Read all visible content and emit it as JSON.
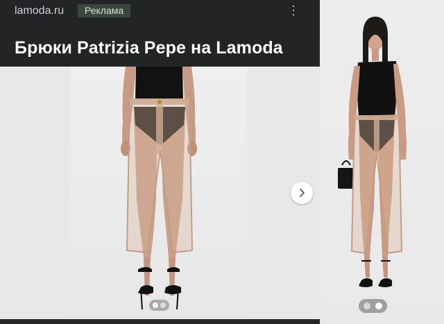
{
  "ad": {
    "domain": "lamoda.ru",
    "badge": "Реклама",
    "title": "Брюки Patrizia Pepe на Lamoda",
    "more_icon": "kebab-vertical-icon",
    "next_icon": "chevron-right-icon"
  },
  "carousel": {
    "main_image_alt": "product-photo-front-closeup",
    "side_image_alt": "product-photo-full-figure",
    "pages": 2,
    "current_page": 1
  },
  "colors": {
    "header_bg": "#222426",
    "badge_bg": "#39473c",
    "photo_bg": "#e9e9e9"
  }
}
